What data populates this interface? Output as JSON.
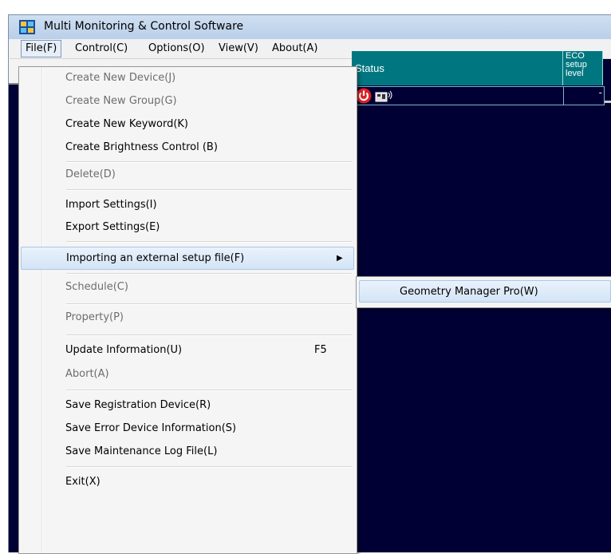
{
  "window": {
    "title": "Multi Monitoring & Control Software"
  },
  "menubar": {
    "items": [
      "File(F)",
      "Control(C)",
      "Options(O)",
      "View(V)",
      "About(A)"
    ]
  },
  "grid": {
    "headers": {
      "status": "Status",
      "eco": "ECO setup level"
    },
    "row": {
      "eco": "-"
    }
  },
  "file_menu": {
    "items": [
      {
        "label": "Create New Device(J)",
        "enabled": false
      },
      {
        "label": "Create New Group(G)",
        "enabled": false
      },
      {
        "label": "Create New Keyword(K)",
        "enabled": true
      },
      {
        "label": "Create Brightness Control (B)",
        "enabled": true
      },
      {
        "label": "Delete(D)",
        "enabled": false
      },
      {
        "label": "Import Settings(I)",
        "enabled": true
      },
      {
        "label": "Export Settings(E)",
        "enabled": true
      },
      {
        "label": "Importing an external setup file(F)",
        "enabled": true,
        "submenu": true
      },
      {
        "label": "Schedule(C)",
        "enabled": false
      },
      {
        "label": "Property(P)",
        "enabled": false
      },
      {
        "label": "Update Information(U)",
        "enabled": true,
        "shortcut": "F5"
      },
      {
        "label": "Abort(A)",
        "enabled": false
      },
      {
        "label": "Save Registration Device(R)",
        "enabled": true
      },
      {
        "label": "Save Error Device Information(S)",
        "enabled": true
      },
      {
        "label": "Save Maintenance Log File(L)",
        "enabled": true
      },
      {
        "label": "Exit(X)",
        "enabled": true
      }
    ]
  },
  "submenu": {
    "items": [
      {
        "label": "Geometry Manager Pro(W)"
      }
    ]
  },
  "colors": {
    "background": "#000034",
    "header": "#007780",
    "highlight": "#d4e4f6"
  }
}
